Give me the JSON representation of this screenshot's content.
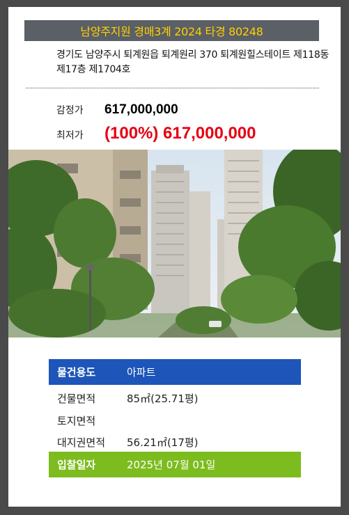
{
  "header": {
    "title": "남양주지원 경매3계 2024 타경 80248"
  },
  "address": "경기도 남양주시 퇴계원읍 퇴계원리 370 퇴계원힐스테이트 제118동 제17층 제1704호",
  "prices": {
    "appraisal_label": "감정가",
    "appraisal_value": "617,000,000",
    "minimum_label": "최저가",
    "minimum_value": "(100%) 617,000,000"
  },
  "details": [
    {
      "label": "물건용도",
      "value": "아파트"
    },
    {
      "label": "건물면적",
      "value": "85㎡(25.71평)"
    },
    {
      "label": "토지면적",
      "value": ""
    },
    {
      "label": "대지권면적",
      "value": "56.21㎡(17평)"
    },
    {
      "label": "입찰일자",
      "value": "2025년 07월 01일"
    }
  ],
  "colors": {
    "title_bg": "#5b5f66",
    "title_text": "#ffd100",
    "minimum_price": "#e60012",
    "usage_row": "#1d55b9",
    "bid_date_row": "#7cbc1e"
  }
}
